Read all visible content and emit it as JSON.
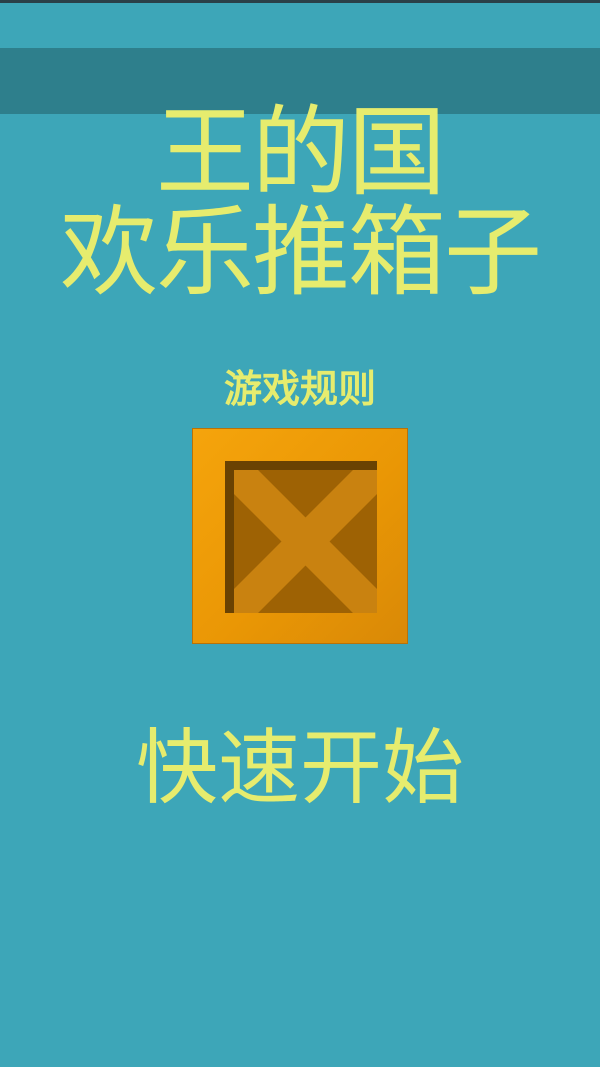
{
  "game": {
    "title_line_1": "王的国",
    "title_line_2": "欢乐推箱子",
    "rules_label": "游戏规则",
    "start_label": "快速开始",
    "crate_icon": "wooden-crate-icon"
  },
  "colors": {
    "background": "#3da6b8",
    "header_bar": "#2e7f8c",
    "text_accent": "#e6ec6e",
    "crate_orange": "#f0a00a",
    "crate_inner": "#a86a05"
  }
}
